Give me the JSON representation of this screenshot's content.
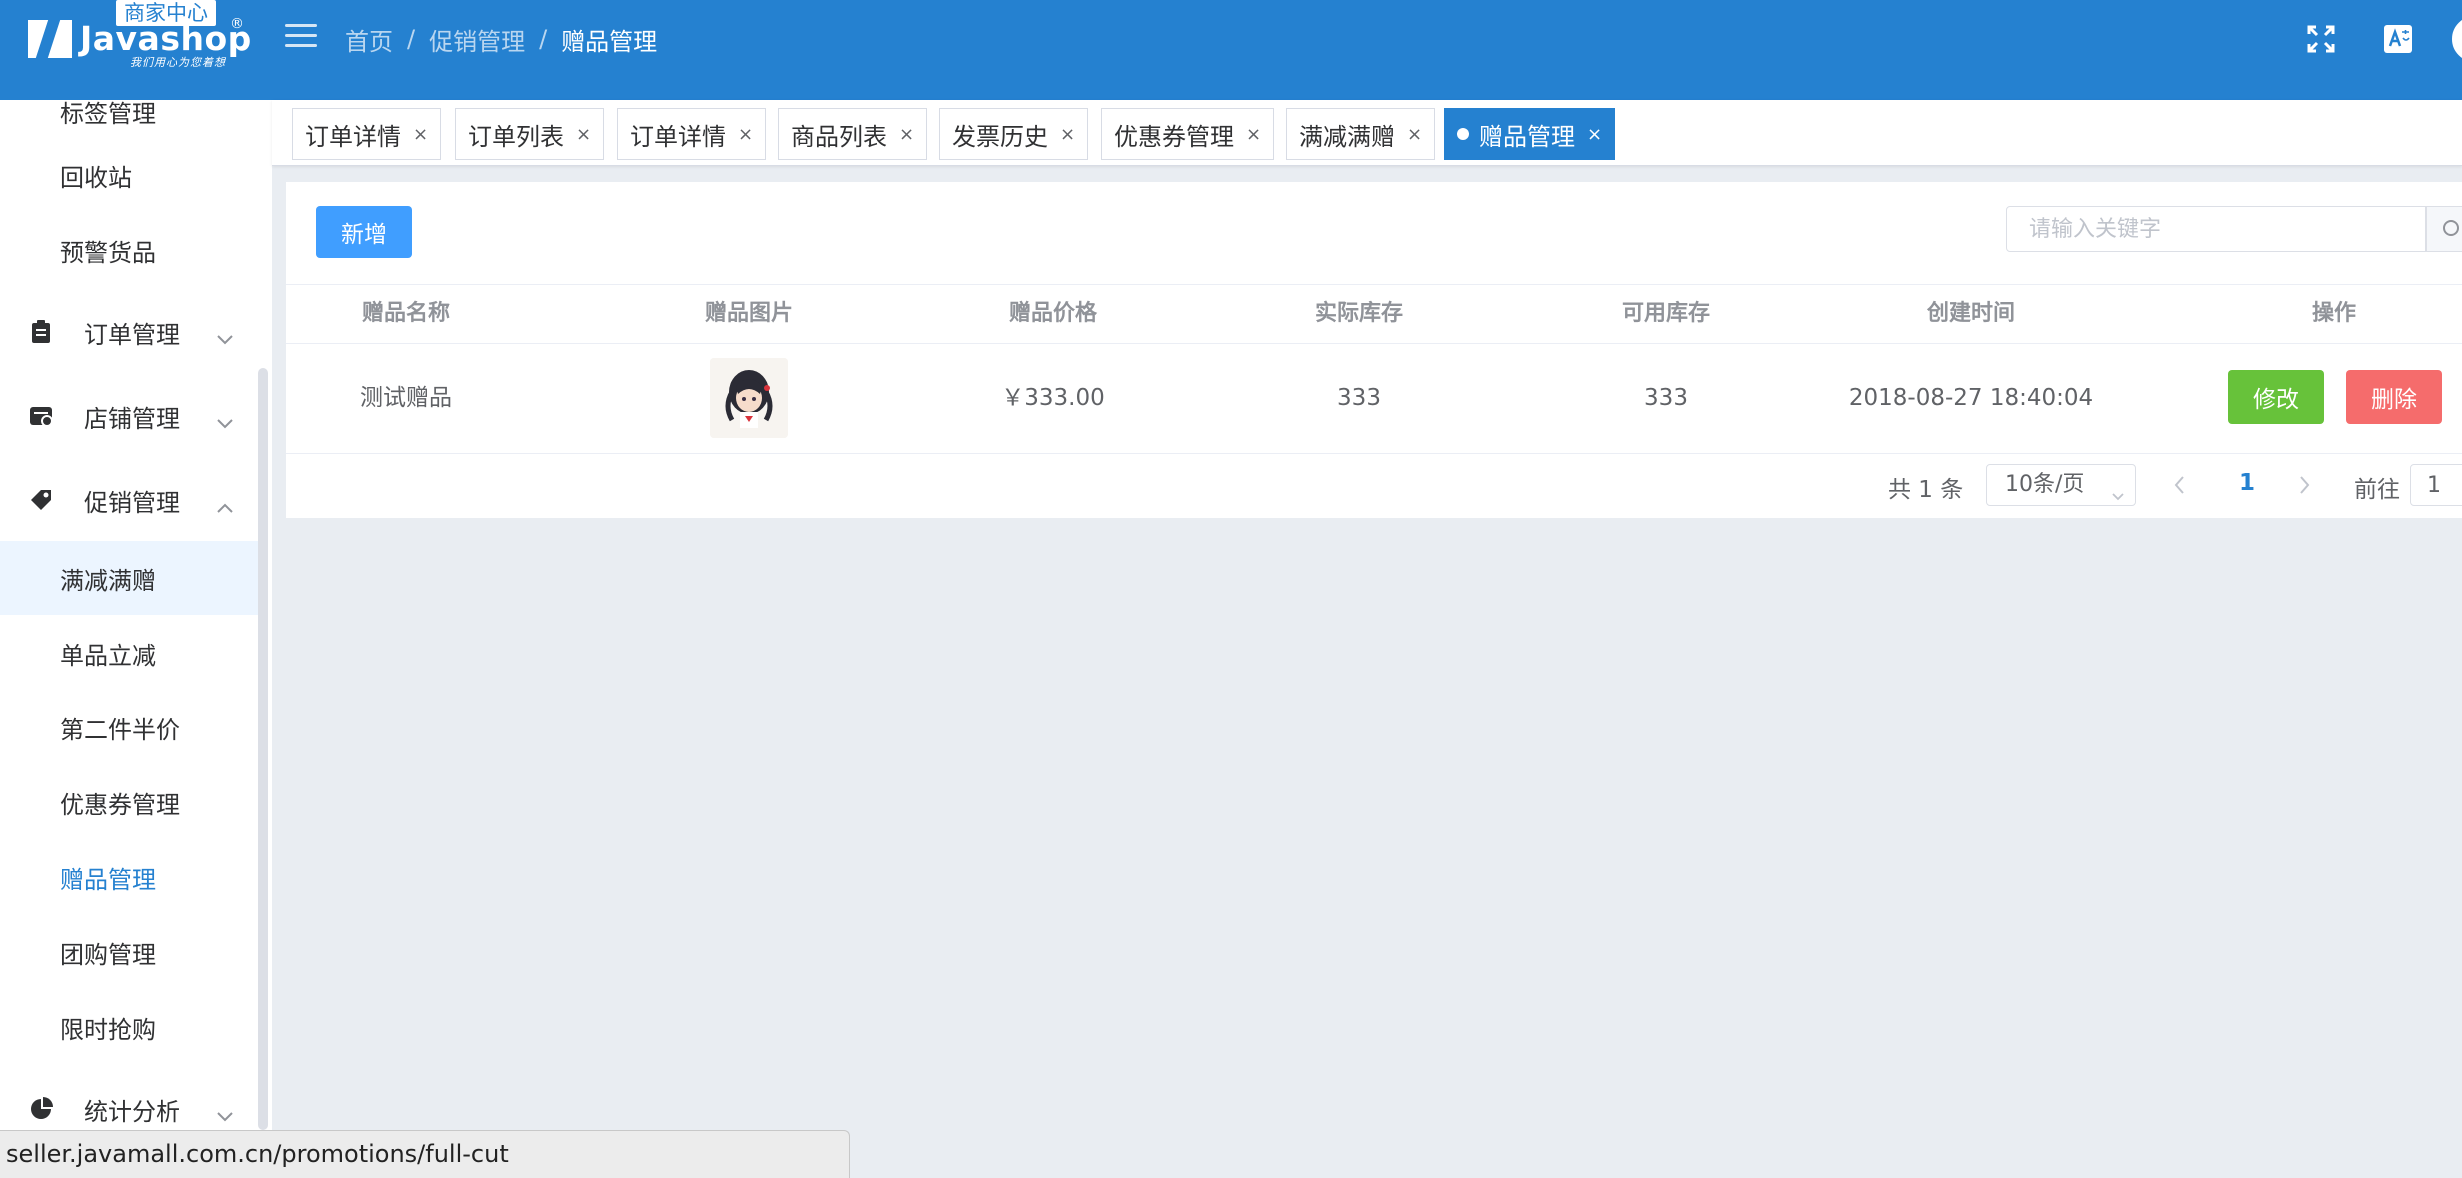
{
  "header": {
    "logo_badge": "商家中心",
    "logo_name": "Javashop",
    "logo_reg": "®",
    "logo_slogan": "我们用心为您着想",
    "breadcrumb": [
      "首页",
      "促销管理",
      "赠品管理"
    ],
    "breadcrumb_sep": "/",
    "brand_color": "#2581d0"
  },
  "sidebar": {
    "items": [
      {
        "label": "标签管理",
        "kind": "sub"
      },
      {
        "label": "回收站",
        "kind": "sub"
      },
      {
        "label": "预警货品",
        "kind": "sub"
      },
      {
        "label": "订单管理",
        "kind": "parent",
        "icon": "clipboard-icon",
        "expanded": false
      },
      {
        "label": "店铺管理",
        "kind": "parent",
        "icon": "shop-icon",
        "expanded": false
      },
      {
        "label": "促销管理",
        "kind": "parent",
        "icon": "tag-icon",
        "expanded": true
      },
      {
        "label": "满减满赠",
        "kind": "sub",
        "highlight": true
      },
      {
        "label": "单品立减",
        "kind": "sub"
      },
      {
        "label": "第二件半价",
        "kind": "sub"
      },
      {
        "label": "优惠券管理",
        "kind": "sub"
      },
      {
        "label": "赠品管理",
        "kind": "sub",
        "active": true
      },
      {
        "label": "团购管理",
        "kind": "sub"
      },
      {
        "label": "限时抢购",
        "kind": "sub"
      },
      {
        "label": "统计分析",
        "kind": "parent",
        "icon": "pie-chart-icon",
        "expanded": false
      }
    ]
  },
  "tags": [
    {
      "label": "订单详情",
      "close": "×"
    },
    {
      "label": "订单列表",
      "close": "×"
    },
    {
      "label": "订单详情",
      "close": "×"
    },
    {
      "label": "商品列表",
      "close": "×"
    },
    {
      "label": "发票历史",
      "close": "×"
    },
    {
      "label": "优惠券管理",
      "close": "×"
    },
    {
      "label": "满减满赠",
      "close": "×"
    },
    {
      "label": "赠品管理",
      "close": "×",
      "active": true
    }
  ],
  "toolbar": {
    "add_label": "新增",
    "search_placeholder": "请输入关键字"
  },
  "table": {
    "columns": [
      "赠品名称",
      "赠品图片",
      "赠品价格",
      "实际库存",
      "可用库存",
      "创建时间",
      "操作"
    ],
    "rows": [
      {
        "name": "测试赠品",
        "image": "anime-character-thumbnail",
        "price": "￥333.00",
        "actual_stock": "333",
        "available_stock": "333",
        "created_at": "2018-08-27 18:40:04",
        "edit_label": "修改",
        "delete_label": "删除"
      }
    ]
  },
  "pagination": {
    "total": "共 1 条",
    "page_size": "10条/页",
    "current_page": "1",
    "goto_label": "前往",
    "goto_value": "1"
  },
  "statusbar": {
    "url": "seller.javamall.com.cn/promotions/full-cut"
  }
}
